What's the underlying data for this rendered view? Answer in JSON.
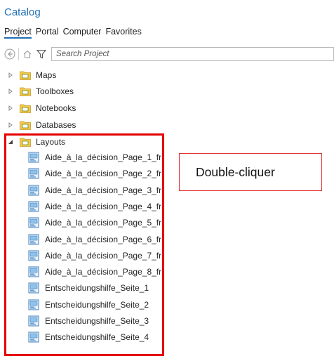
{
  "panel": {
    "title": "Catalog"
  },
  "tabs": [
    {
      "label": "Project",
      "active": true
    },
    {
      "label": "Portal",
      "active": false
    },
    {
      "label": "Computer",
      "active": false
    },
    {
      "label": "Favorites",
      "active": false
    }
  ],
  "search": {
    "placeholder": "Search Project"
  },
  "folders": [
    {
      "label": "Maps",
      "expanded": false,
      "icon": "maps-folder-icon"
    },
    {
      "label": "Toolboxes",
      "expanded": false,
      "icon": "toolboxes-folder-icon"
    },
    {
      "label": "Notebooks",
      "expanded": false,
      "icon": "notebooks-folder-icon"
    },
    {
      "label": "Databases",
      "expanded": false,
      "icon": "databases-folder-icon"
    },
    {
      "label": "Layouts",
      "expanded": true,
      "icon": "layouts-folder-icon"
    }
  ],
  "layouts": [
    "Aide_à_la_décision_Page_1_fr",
    "Aide_à_la_décision_Page_2_fr",
    "Aide_à_la_décision_Page_3_fr",
    "Aide_à_la_décision_Page_4_fr",
    "Aide_à_la_décision_Page_5_fr",
    "Aide_à_la_décision_Page_6_fr",
    "Aide_à_la_décision_Page_7_fr",
    "Aide_à_la_décision_Page_8_fr",
    "Entscheidungshilfe_Seite_1",
    "Entscheidungshilfe_Seite_2",
    "Entscheidungshilfe_Seite_3",
    "Entscheidungshilfe_Seite_4"
  ],
  "callout": {
    "text": "Double-cliquer"
  },
  "colors": {
    "accent": "#1f6fb3",
    "highlight": "#e60000",
    "folder": "#f2c94c"
  }
}
